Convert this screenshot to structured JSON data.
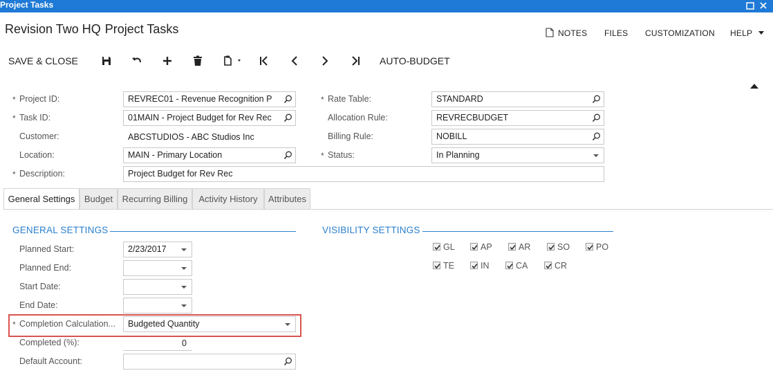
{
  "window": {
    "title": "Project Tasks"
  },
  "screen": {
    "title_part1": "Revision Two HQ",
    "title_part2": "Project Tasks"
  },
  "topmenu": {
    "notes": "NOTES",
    "files": "FILES",
    "customization": "CUSTOMIZATION",
    "help": "HELP"
  },
  "toolbar": {
    "save_close": "SAVE & CLOSE",
    "auto_budget": "AUTO-BUDGET"
  },
  "header_form": {
    "project_id": {
      "label": "Project ID:",
      "value": "REVREC01 - Revenue Recognition P"
    },
    "task_id": {
      "label": "Task ID:",
      "value": "01MAIN - Project Budget for Rev Rec"
    },
    "customer": {
      "label": "Customer:",
      "value": "ABCSTUDIOS - ABC Studios Inc"
    },
    "location": {
      "label": "Location:",
      "value": "MAIN - Primary Location"
    },
    "description": {
      "label": "Description:",
      "value": "Project Budget for Rev Rec"
    },
    "rate_table": {
      "label": "Rate Table:",
      "value": "STANDARD"
    },
    "allocation_rule": {
      "label": "Allocation Rule:",
      "value": "REVRECBUDGET"
    },
    "billing_rule": {
      "label": "Billing Rule:",
      "value": "NOBILL"
    },
    "status": {
      "label": "Status:",
      "value": "In Planning"
    },
    "required_mark": "*"
  },
  "tabs": [
    {
      "label": "General Settings"
    },
    {
      "label": "Budget"
    },
    {
      "label": "Recurring Billing"
    },
    {
      "label": "Activity History"
    },
    {
      "label": "Attributes"
    }
  ],
  "general_settings": {
    "title": "GENERAL SETTINGS",
    "planned_start": {
      "label": "Planned Start:",
      "value": "2/23/2017"
    },
    "planned_end": {
      "label": "Planned End:",
      "value": ""
    },
    "start_date": {
      "label": "Start Date:",
      "value": ""
    },
    "end_date": {
      "label": "End Date:",
      "value": ""
    },
    "completion_calc": {
      "label": "Completion Calculation...",
      "value": "Budgeted Quantity"
    },
    "completed": {
      "label": "Completed (%):",
      "value": "0"
    },
    "default_account": {
      "label": "Default Account:",
      "value": ""
    }
  },
  "visibility_settings": {
    "title": "VISIBILITY SETTINGS",
    "checkboxes": [
      {
        "label": "GL",
        "checked": true
      },
      {
        "label": "AP",
        "checked": true
      },
      {
        "label": "AR",
        "checked": true
      },
      {
        "label": "SO",
        "checked": true
      },
      {
        "label": "PO",
        "checked": true
      },
      {
        "label": "TE",
        "checked": true
      },
      {
        "label": "IN",
        "checked": true
      },
      {
        "label": "CA",
        "checked": true
      },
      {
        "label": "CR",
        "checked": true
      }
    ]
  },
  "colors": {
    "titlebar": "#1e7ad6",
    "section_accent": "#2a7fcc",
    "highlight": "#d9534f"
  }
}
